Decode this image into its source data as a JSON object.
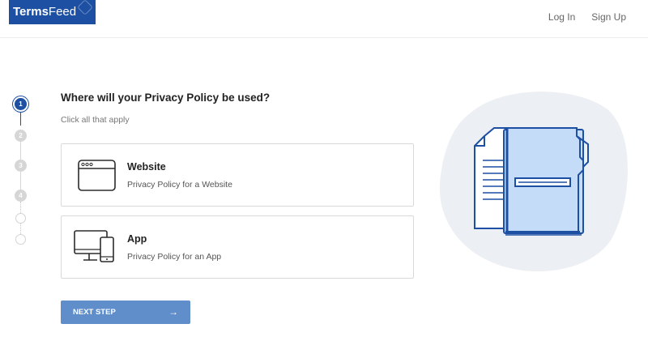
{
  "header": {
    "logo_bold": "Terms",
    "logo_light": "Feed",
    "nav": {
      "login": "Log In",
      "signup": "Sign Up"
    }
  },
  "stepper": {
    "steps": [
      "1",
      "2",
      "3",
      "4"
    ],
    "active_step": 1
  },
  "main": {
    "title": "Where will your Privacy Policy be used?",
    "subtitle": "Click all that apply",
    "options": [
      {
        "title": "Website",
        "description": "Privacy Policy for a Website",
        "icon": "browser-window-icon"
      },
      {
        "title": "App",
        "description": "Privacy Policy for an App",
        "icon": "desktop-and-phone-icon"
      }
    ],
    "next_button": {
      "label": "NEXT STEP",
      "arrow": "→"
    }
  },
  "illustration": {
    "icon": "document-folder-icon"
  },
  "colors": {
    "brand": "#1d4fa3",
    "button": "#5f8ecb",
    "illustration_bg": "#eceff3",
    "illustration_fill": "#c5dcf8"
  }
}
